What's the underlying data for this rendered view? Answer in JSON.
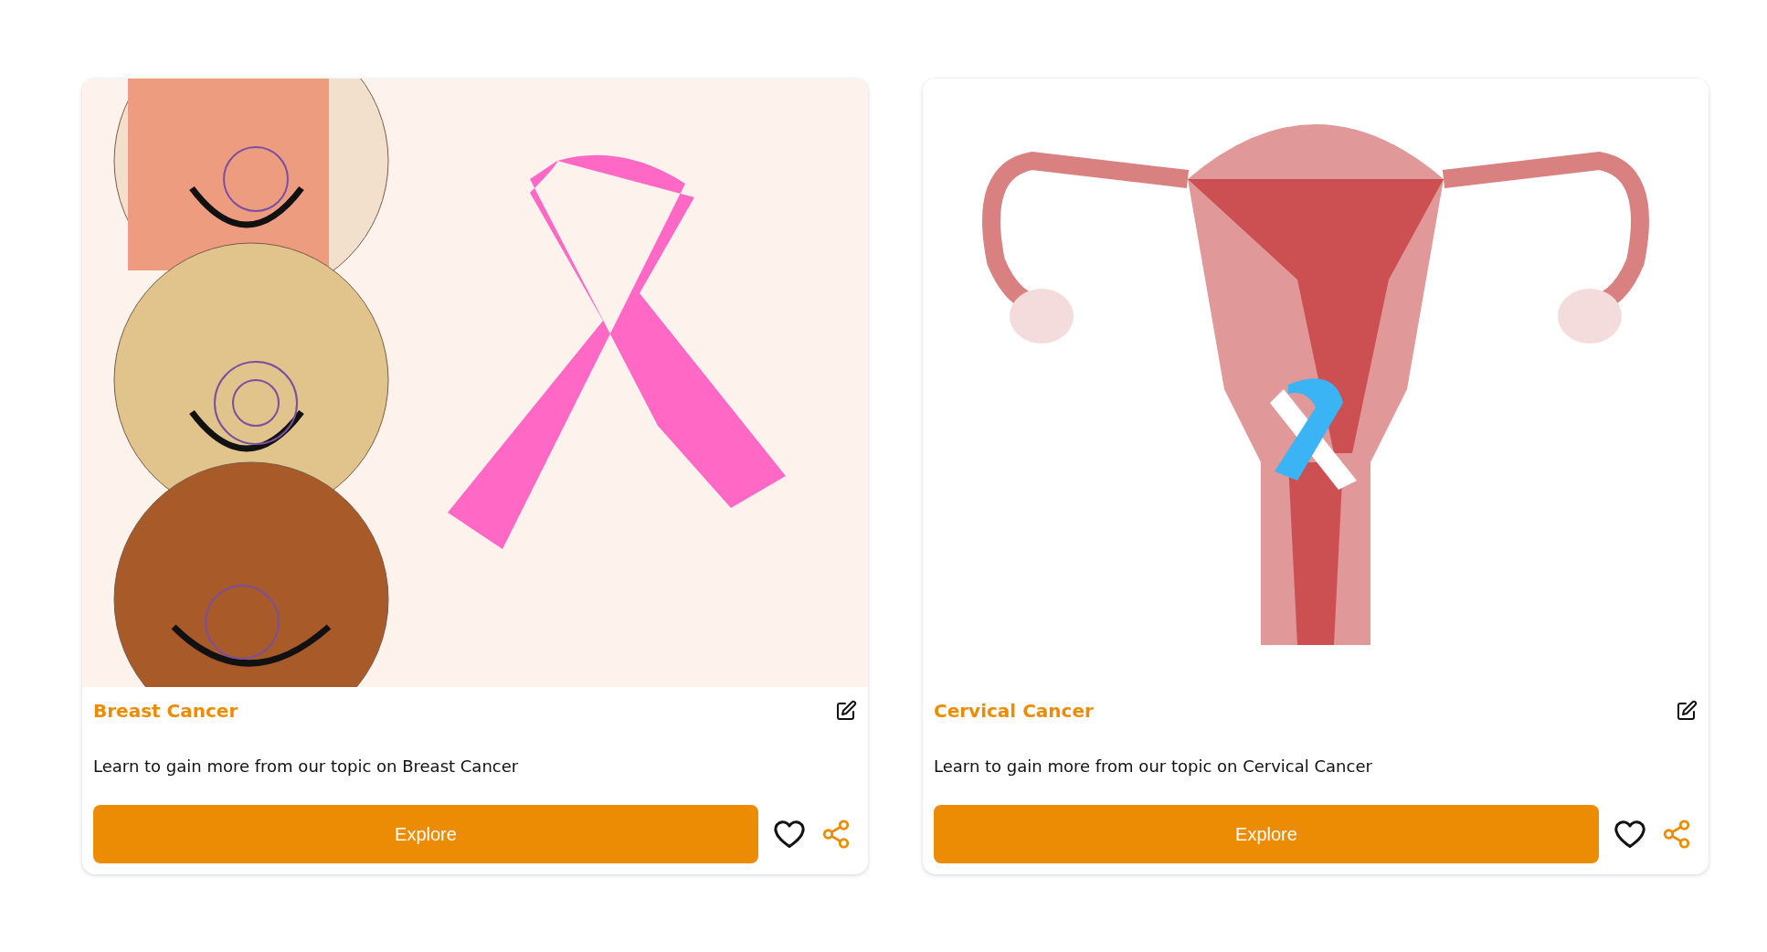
{
  "cards": [
    {
      "kind": "breast",
      "title": "Breast Cancer",
      "description": "Learn to gain more from our topic on Breast Cancer",
      "button": "Explore"
    },
    {
      "kind": "cervical",
      "title": "Cervical Cancer",
      "description": "Learn to gain more from our topic on Cervical Cancer",
      "button": "Explore"
    }
  ]
}
